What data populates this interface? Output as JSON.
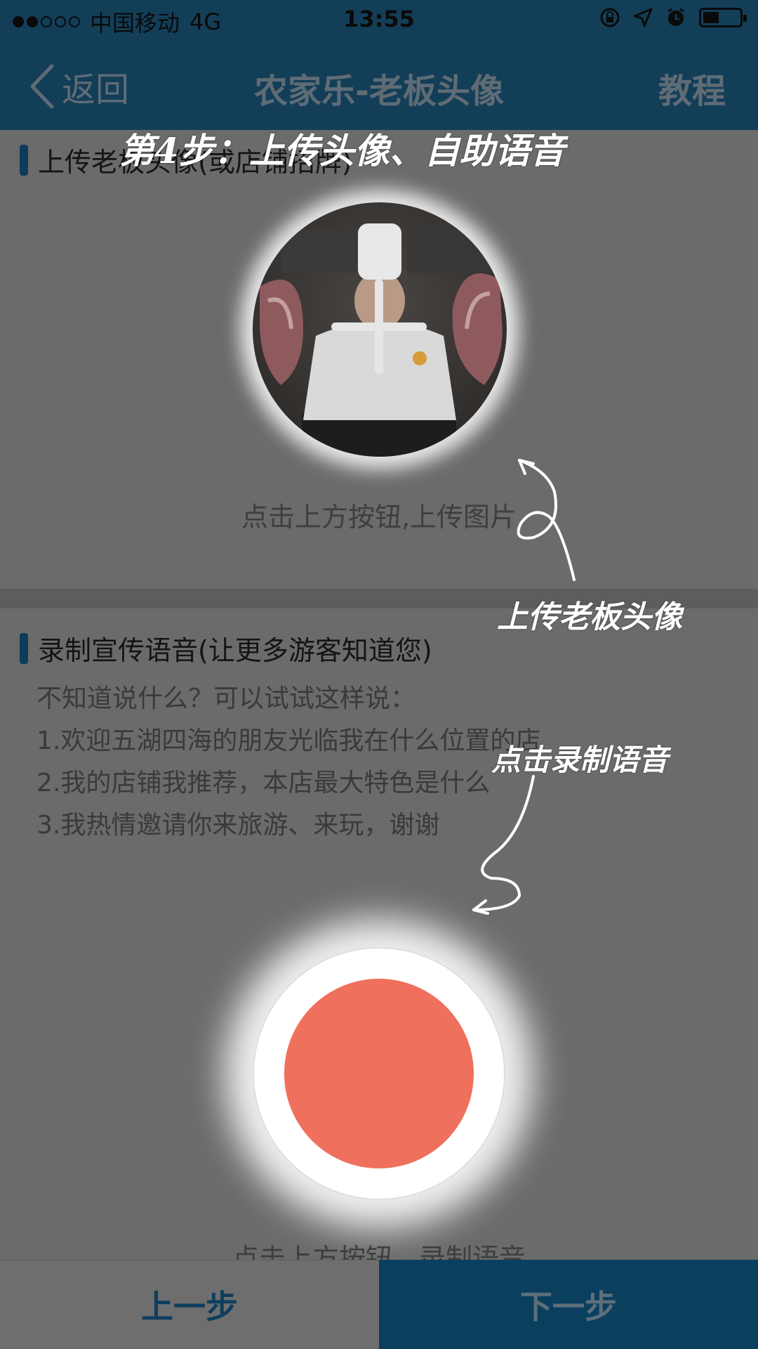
{
  "status_bar": {
    "carrier": "中国移动",
    "network": "4G",
    "time": "13:55",
    "signal_full": 2,
    "signal_total": 5,
    "battery_level": 0.4
  },
  "nav": {
    "back_label": "返回",
    "title": "农家乐-老板头像",
    "tutorial_label": "教程"
  },
  "section_avatar": {
    "heading": "上传老板头像(或店铺招牌)",
    "hint": "点击上方按钮,上传图片"
  },
  "section_voice": {
    "heading": "录制宣传语音(让更多游客知道您)",
    "tips": [
      "不知道说什么？可以试试这样说：",
      "1.欢迎五湖四海的朋友光临我在什么位置的店",
      "2.我的店铺我推荐，本店最大特色是什么",
      "3.我热情邀请你来旅游、来玩，谢谢"
    ],
    "hint": "点击上方按钮，录制语音"
  },
  "bottom": {
    "prev_label": "上一步",
    "next_label": "下一步"
  },
  "overlay": {
    "step_title": "第4步：上传头像、自助语音",
    "avatar_note": "上传老板头像",
    "record_note": "点击录制语音"
  },
  "colors": {
    "header_bg": "#133e58",
    "accent": "#0d3c5c",
    "record_button": "#ef705c",
    "overlay_dim": "#6b6b6b"
  }
}
